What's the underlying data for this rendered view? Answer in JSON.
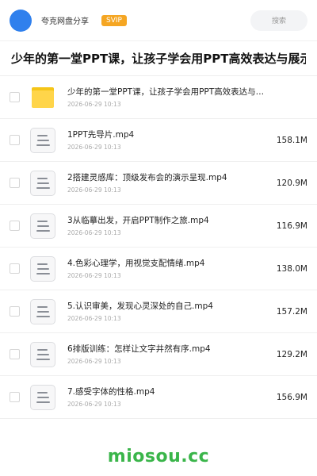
{
  "header": {
    "share_name": "夸克网盘分享",
    "badge": "SVIP",
    "search_placeholder": "搜索"
  },
  "page_title": "少年的第一堂PPT课，让孩子学会用PPT高效表达与展示",
  "folder": {
    "name": "少年的第一堂PPT课，让孩子学会用PPT高效表达与…",
    "date": "2026-06-29 10:13",
    "icon": "folder-icon"
  },
  "files": [
    {
      "name": "1PPT先导片.mp4",
      "date": "2026-06-29 10:13",
      "size": "158.1M"
    },
    {
      "name": "2搭建灵感库：顶级发布会的演示呈现.mp4",
      "date": "2026-06-29 10:13",
      "size": "120.9M"
    },
    {
      "name": "3从临摹出发，开启PPT制作之旅.mp4",
      "date": "2026-06-29 10:13",
      "size": "116.9M"
    },
    {
      "name": "4.色彩心理学，用视觉支配情绪.mp4",
      "date": "2026-06-29 10:13",
      "size": "138.0M"
    },
    {
      "name": "5.认识审美，发现心灵深处的自己.mp4",
      "date": "2026-06-29 10:13",
      "size": "157.2M"
    },
    {
      "name": "6排版训练：怎样让文字井然有序.mp4",
      "date": "2026-06-29 10:13",
      "size": "129.2M"
    },
    {
      "name": "7.感受字体的性格.mp4",
      "date": "2026-06-29 10:13",
      "size": "156.9M"
    }
  ],
  "watermark": "miosou.cc",
  "colors": {
    "avatar": "#2f80ed",
    "badge": "#f5a623",
    "folder": "#ffd54a",
    "watermark": "#3ab54a"
  }
}
